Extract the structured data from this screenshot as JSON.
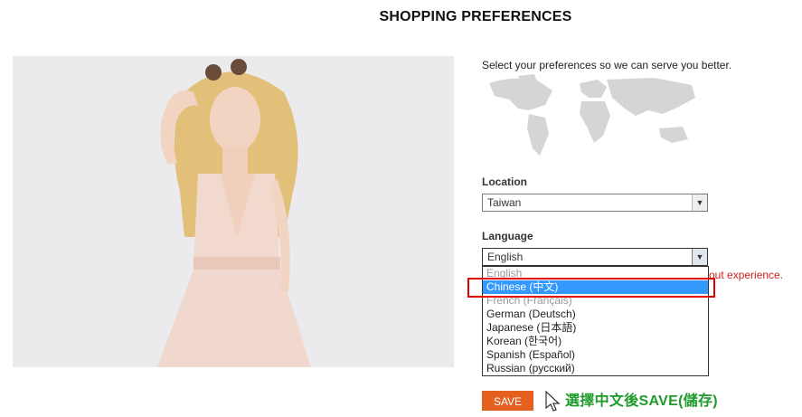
{
  "page": {
    "title": "SHOPPING PREFERENCES",
    "intro": "Select your preferences so we can serve you better."
  },
  "location": {
    "label": "Location",
    "value": "Taiwan"
  },
  "language": {
    "label": "Language",
    "value": "English",
    "options": [
      "English",
      "Chinese (中文)",
      "French (Français)",
      "German (Deutsch)",
      "Japanese (日本語)",
      "Korean (한국어)",
      "Spanish (Español)",
      "Russian (русский)"
    ],
    "highlighted_option": "Chinese (中文)"
  },
  "hint_text": "out experience.",
  "save_label": "SAVE",
  "annotation": "選擇中文後SAVE(儲存)",
  "colors": {
    "save_button": "#e4601f",
    "highlight": "#3399ff",
    "annotation": "#1f9a2a",
    "callout_box": "#e00000"
  },
  "icons": {
    "dropdown": "chevron-down-icon",
    "map": "world-map-icon",
    "pointer": "mouse-cursor-icon"
  }
}
